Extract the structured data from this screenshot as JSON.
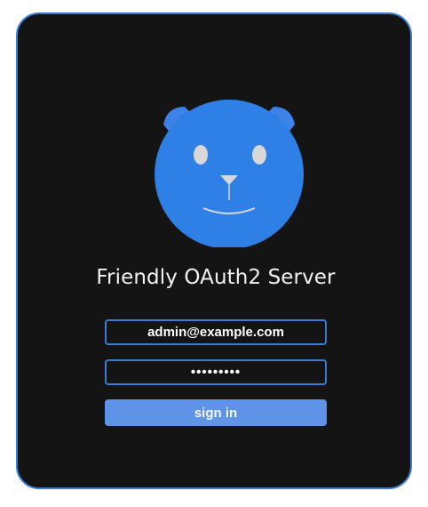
{
  "app": {
    "title": "Friendly OAuth2 Server"
  },
  "login": {
    "email_value": "admin@example.com",
    "password_value": "•••••••••",
    "signin_label": "sign in"
  },
  "icons": {
    "logo": "bear-logo-icon"
  },
  "colors": {
    "card_background": "#141414",
    "accent_border": "#3a7bd5",
    "logo_face": "#2f80e6",
    "button_background": "#5f93e8",
    "text": "#f2f2f2"
  }
}
